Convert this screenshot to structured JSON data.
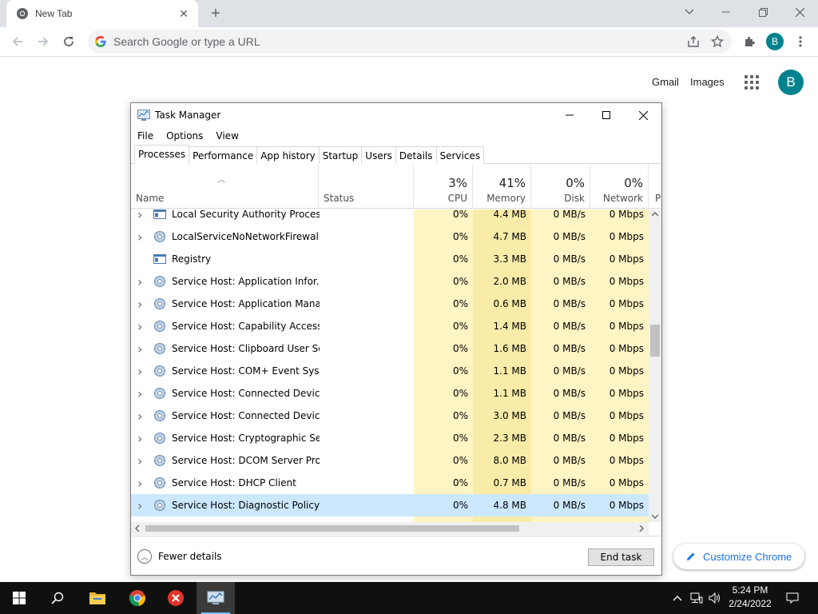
{
  "browser": {
    "tab_title": "New Tab",
    "omnibox_placeholder": "Search Google or type a URL",
    "profile_initial": "B",
    "accent_color": "#00838f"
  },
  "ntp": {
    "gmail_label": "Gmail",
    "images_label": "Images",
    "profile_initial": "B",
    "customize_label": "Customize Chrome"
  },
  "task_manager": {
    "title": "Task Manager",
    "menu": [
      "File",
      "Options",
      "View"
    ],
    "tabs": [
      "Processes",
      "Performance",
      "App history",
      "Startup",
      "Users",
      "Details",
      "Services"
    ],
    "active_tab": "Processes",
    "columns": {
      "name": "Name",
      "status": "Status",
      "cpu": {
        "label": "CPU",
        "pct": "3%"
      },
      "memory": {
        "label": "Memory",
        "pct": "41%"
      },
      "disk": {
        "label": "Disk",
        "pct": "0%"
      },
      "network": {
        "label": "Network",
        "pct": "0%"
      },
      "more": "P"
    },
    "rows": [
      {
        "name": "Local Security Authority Process...",
        "icon": "window-icon",
        "expandable": true,
        "cpu": "0%",
        "memory": "4.4 MB",
        "disk": "0 MB/s",
        "network": "0 Mbps"
      },
      {
        "name": "LocalServiceNoNetworkFirewall ...",
        "icon": "gear-icon",
        "expandable": true,
        "cpu": "0%",
        "memory": "4.7 MB",
        "disk": "0 MB/s",
        "network": "0 Mbps"
      },
      {
        "name": "Registry",
        "icon": "window-icon",
        "expandable": false,
        "cpu": "0%",
        "memory": "3.3 MB",
        "disk": "0 MB/s",
        "network": "0 Mbps"
      },
      {
        "name": "Service Host: Application Infor...",
        "icon": "gear-icon",
        "expandable": true,
        "cpu": "0%",
        "memory": "2.0 MB",
        "disk": "0 MB/s",
        "network": "0 Mbps"
      },
      {
        "name": "Service Host: Application Mana...",
        "icon": "gear-icon",
        "expandable": true,
        "cpu": "0%",
        "memory": "0.6 MB",
        "disk": "0 MB/s",
        "network": "0 Mbps"
      },
      {
        "name": "Service Host: Capability Access ...",
        "icon": "gear-icon",
        "expandable": true,
        "cpu": "0%",
        "memory": "1.4 MB",
        "disk": "0 MB/s",
        "network": "0 Mbps"
      },
      {
        "name": "Service Host: Clipboard User Ser...",
        "icon": "gear-icon",
        "expandable": true,
        "cpu": "0%",
        "memory": "1.6 MB",
        "disk": "0 MB/s",
        "network": "0 Mbps"
      },
      {
        "name": "Service Host: COM+ Event Syste...",
        "icon": "gear-icon",
        "expandable": true,
        "cpu": "0%",
        "memory": "1.1 MB",
        "disk": "0 MB/s",
        "network": "0 Mbps"
      },
      {
        "name": "Service Host: Connected Device...",
        "icon": "gear-icon",
        "expandable": true,
        "cpu": "0%",
        "memory": "1.1 MB",
        "disk": "0 MB/s",
        "network": "0 Mbps"
      },
      {
        "name": "Service Host: Connected Device...",
        "icon": "gear-icon",
        "expandable": true,
        "cpu": "0%",
        "memory": "3.0 MB",
        "disk": "0 MB/s",
        "network": "0 Mbps"
      },
      {
        "name": "Service Host: Cryptographic Ser...",
        "icon": "gear-icon",
        "expandable": true,
        "cpu": "0%",
        "memory": "2.3 MB",
        "disk": "0 MB/s",
        "network": "0 Mbps"
      },
      {
        "name": "Service Host: DCOM Server Proc...",
        "icon": "gear-icon",
        "expandable": true,
        "cpu": "0%",
        "memory": "8.0 MB",
        "disk": "0 MB/s",
        "network": "0 Mbps"
      },
      {
        "name": "Service Host: DHCP Client",
        "icon": "gear-icon",
        "expandable": true,
        "cpu": "0%",
        "memory": "0.7 MB",
        "disk": "0 MB/s",
        "network": "0 Mbps"
      },
      {
        "name": "Service Host: Diagnostic Policy ...",
        "icon": "gear-icon",
        "expandable": true,
        "cpu": "0%",
        "memory": "4.8 MB",
        "disk": "0 MB/s",
        "network": "0 Mbps",
        "selected": true
      }
    ],
    "fewer_details_label": "Fewer details",
    "end_task_label": "End task"
  },
  "taskbar": {
    "time": "5:24 PM",
    "date": "2/24/2022"
  }
}
